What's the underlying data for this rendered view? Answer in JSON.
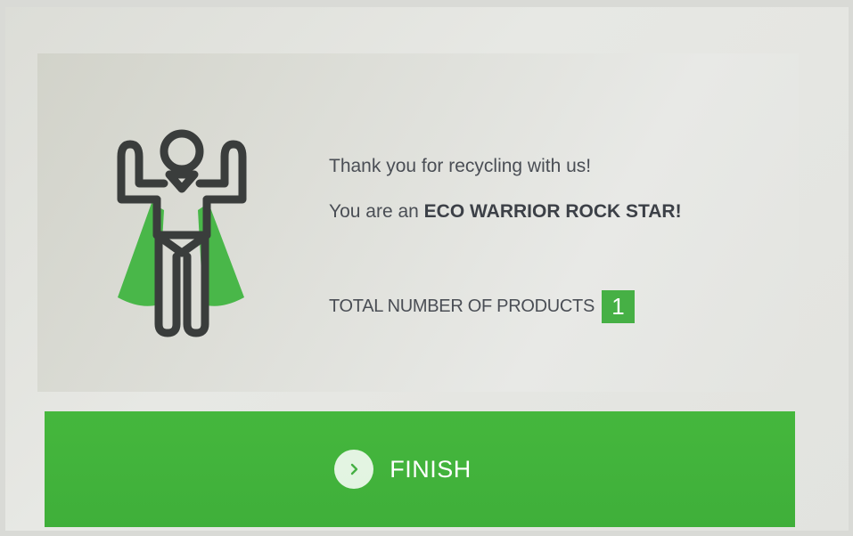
{
  "message": {
    "line1": "Thank you for recycling with us!",
    "line2_prefix": "You are an ",
    "line2_emphasis": "ECO WARRIOR ROCK STAR!"
  },
  "total": {
    "label": "TOTAL NUMBER OF PRODUCTS",
    "count": "1"
  },
  "finish_button": {
    "label": "FINISH",
    "icon": "chevron-right-icon"
  },
  "colors": {
    "accent_green": "#46b045",
    "text": "#4a4e55",
    "figure_stroke": "#3a3d3c"
  },
  "illustration": {
    "icon": "eco-warrior-superhero-icon"
  }
}
